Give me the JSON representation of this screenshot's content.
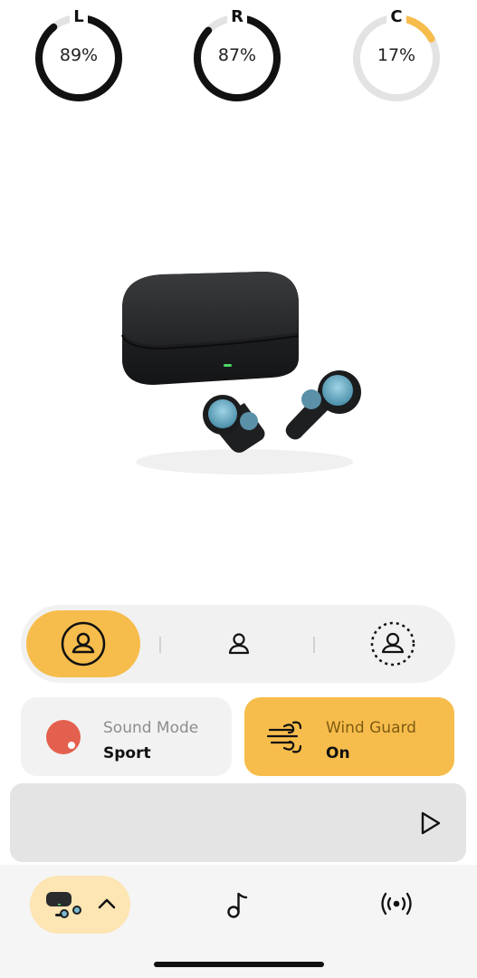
{
  "battery": {
    "left": {
      "label": "L",
      "percent": 89,
      "text": "89%",
      "color": "#111111"
    },
    "right": {
      "label": "R",
      "percent": 87,
      "text": "87%",
      "color": "#111111"
    },
    "case": {
      "label": "C",
      "percent": 17,
      "text": "17%",
      "color": "#f7bd4c"
    },
    "track_color": "#e3e3e3"
  },
  "product_image": {
    "icon": "earbuds-with-case-image"
  },
  "mode_selector": {
    "items": [
      {
        "icon": "person-circle-icon",
        "active": true
      },
      {
        "icon": "person-icon",
        "active": false
      },
      {
        "icon": "person-dashed-circle-icon",
        "active": false
      }
    ],
    "accent": "#f7bd4c"
  },
  "sound_mode": {
    "title": "Sound Mode",
    "value": "Sport",
    "dot_color": "#e4604e"
  },
  "wind_guard": {
    "title": "Wind Guard",
    "value": "On",
    "icon": "wind-icon"
  },
  "player": {
    "play_icon": "play-icon"
  },
  "bottom_nav": {
    "items": [
      {
        "icon": "earbuds-device-icon",
        "extra_icon": "chevron-up-icon",
        "active": true
      },
      {
        "icon": "music-note-icon",
        "active": false
      },
      {
        "icon": "broadcast-icon",
        "active": false
      }
    ]
  }
}
